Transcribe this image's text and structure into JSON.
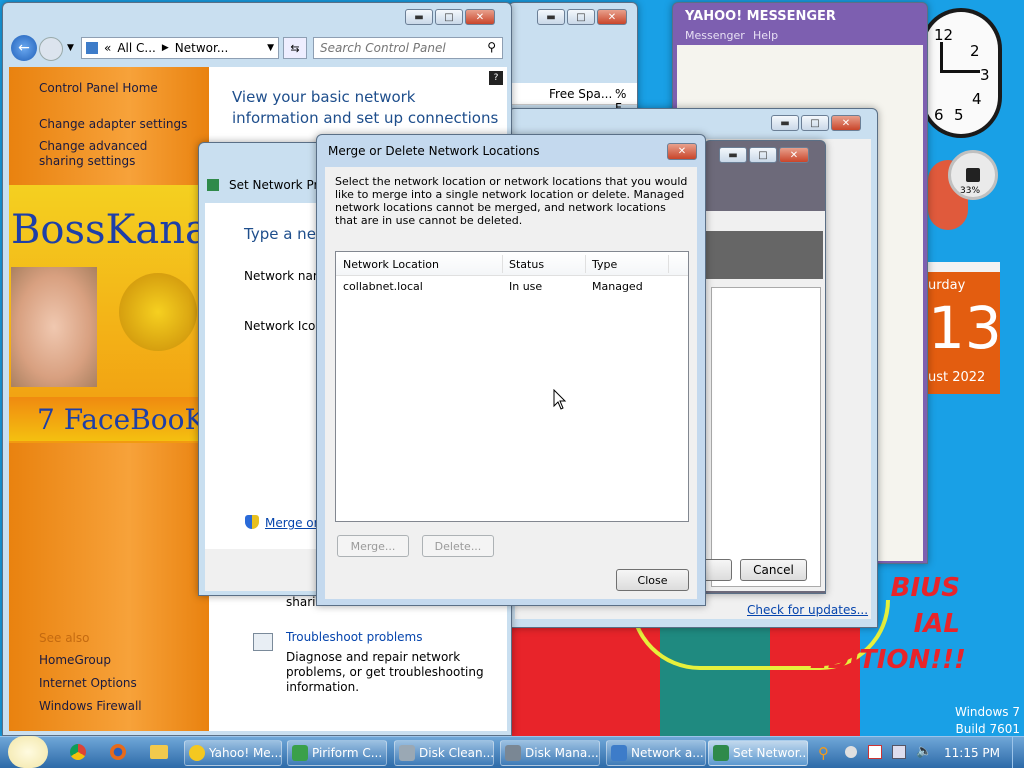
{
  "cp": {
    "address": [
      "All C...",
      "Networ..."
    ],
    "search_placeholder": "Search Control Panel",
    "sidebar": [
      "Control Panel Home",
      "Change adapter settings",
      "Change advanced sharing settings"
    ],
    "banner_top": "BossKanae",
    "banner_bottom": "7 FaceBooK",
    "see_also": "See also",
    "see_also_items": [
      "HomeGroup",
      "Internet Options",
      "Windows Firewall"
    ],
    "heading": "View your basic network information and set up connections",
    "troubleshoot_title": "Troubleshoot problems",
    "troubleshoot_desc": "Diagnose and repair network problems, or get troubleshooting information.",
    "sharing_fragment": "sharin"
  },
  "explorer": {
    "col_free": "Free Spa...",
    "col_pct": "% F"
  },
  "set_net": {
    "title": "Set Network Prop",
    "heading": "Type a net",
    "name_label": "Network nam",
    "icon_label": "Network Icon",
    "merge_link": "Merge or"
  },
  "back_dialog": {
    "cancel": "Cancel",
    "check_updates": "Check for updates..."
  },
  "merge": {
    "title": "Merge or Delete Network Locations",
    "description": "Select the network location or network locations that you would like to merge into a single network location or delete. Managed network locations cannot be merged, and network locations that are in use cannot be deleted.",
    "columns": [
      "Network Location",
      "Status",
      "Type"
    ],
    "rows": [
      {
        "location": "collabnet.local",
        "status": "In use",
        "type": "Managed"
      }
    ],
    "merge_btn": "Merge...",
    "delete_btn": "Delete...",
    "close_btn": "Close"
  },
  "yahoo": {
    "title": "YAHOO! MESSENGER",
    "menu": [
      "Messenger",
      "Help"
    ]
  },
  "gadgets": {
    "clock_numbers": [
      "12",
      "2",
      "3",
      "4",
      "5",
      "6"
    ],
    "cpu_pct": "33%",
    "cal_day": "urday",
    "cal_date": "13",
    "cal_month": "ust 2022"
  },
  "wallpaper": {
    "text": "BIUS\nIAL\nEDITION!!!",
    "watermark_1": "Windows 7",
    "watermark_2": "Build 7601"
  },
  "taskbar": {
    "items": [
      "Yahoo! Me...",
      "Piriform C...",
      "Disk Clean...",
      "Disk Mana...",
      "Network a...",
      "Set Networ..."
    ],
    "clock": "11:15 PM"
  }
}
